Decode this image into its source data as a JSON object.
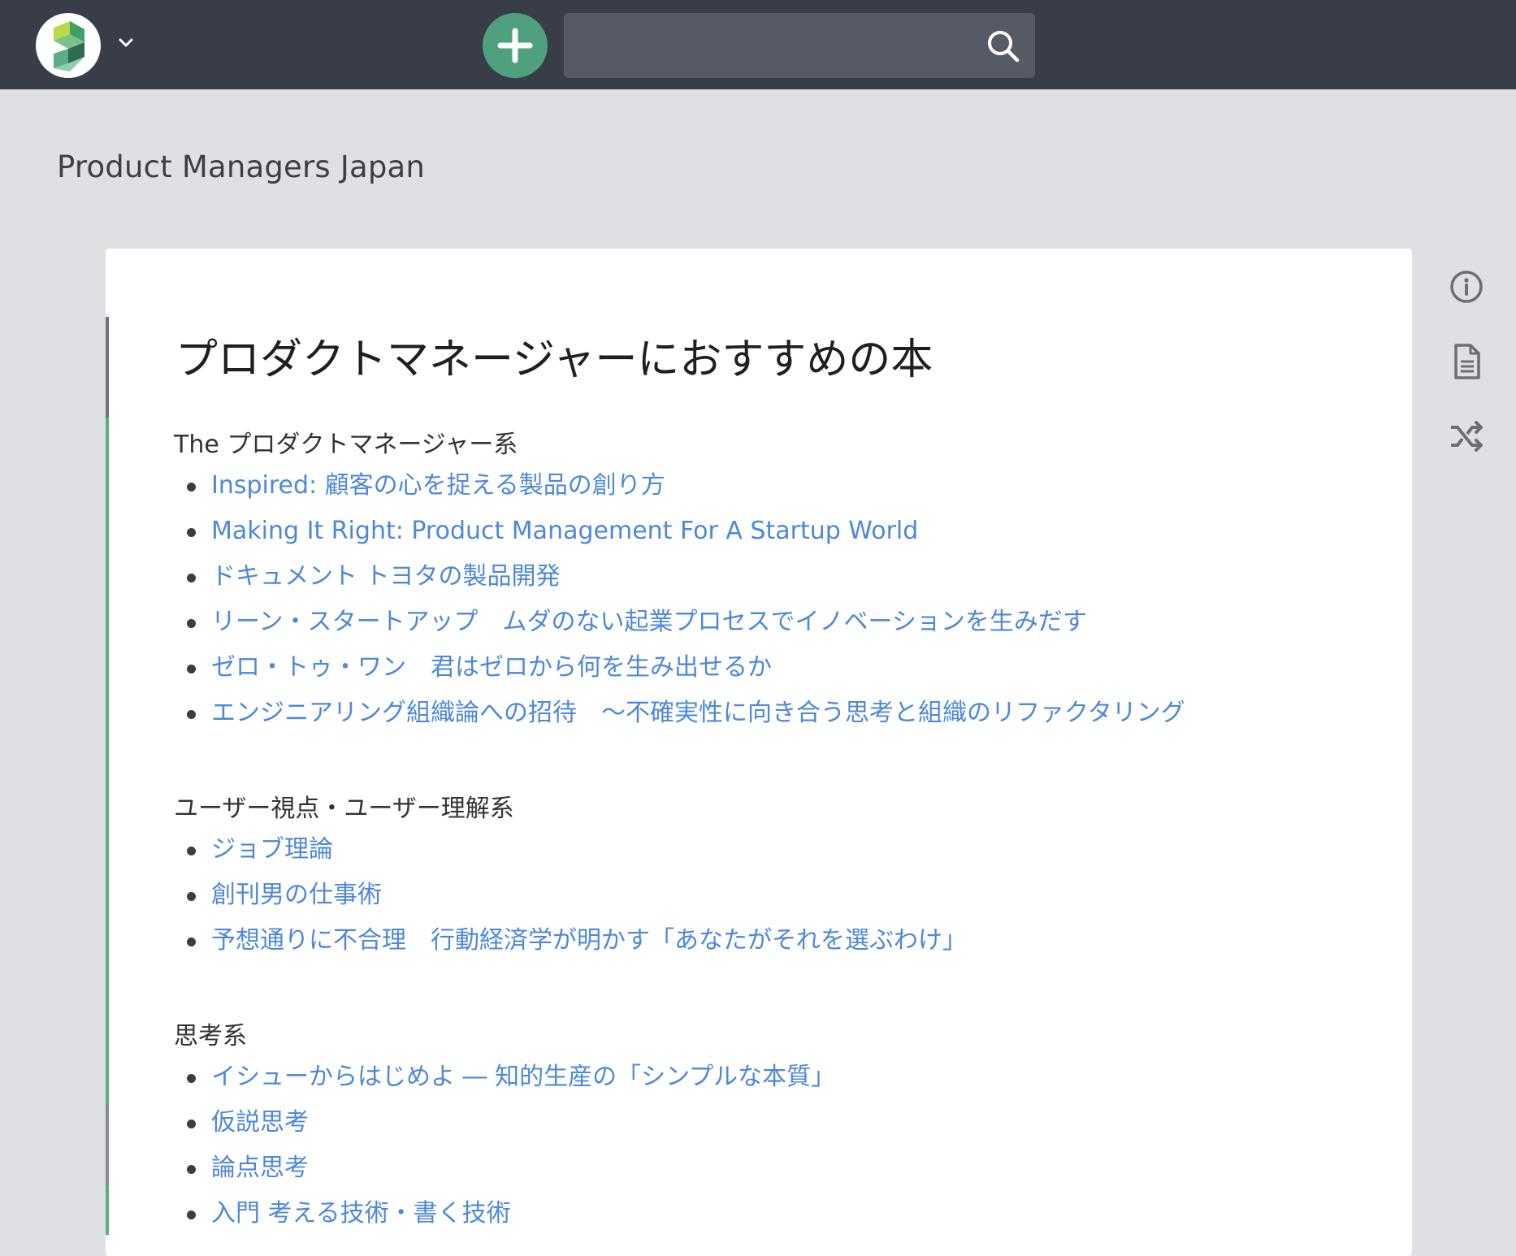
{
  "header": {
    "search": {
      "value": "",
      "placeholder": ""
    },
    "icons": [
      "app-logo",
      "chevron-down-icon",
      "plus-icon",
      "search-icon"
    ]
  },
  "project": {
    "name": "Product Managers Japan"
  },
  "page": {
    "title": "プロダクトマネージャーにおすすめの本",
    "sections": [
      {
        "heading": "The プロダクトマネージャー系",
        "items": [
          "Inspired: 顧客の心を捉える製品の創り方",
          "Making It Right: Product Management For A Startup World",
          "ドキュメント トヨタの製品開発",
          "リーン・スタートアップ　ムダのない起業プロセスでイノベーションを生みだす",
          "ゼロ・トゥ・ワン　君はゼロから何を生み出せるか",
          "エンジニアリング組織論への招待　～不確実性に向き合う思考と組織のリファクタリング"
        ]
      },
      {
        "heading": "ユーザー視点・ユーザー理解系",
        "items": [
          "ジョブ理論",
          "創刊男の仕事術",
          "予想通りに不合理　行動経済学が明かす「あなたがそれを選ぶわけ」"
        ]
      },
      {
        "heading": "思考系",
        "items": [
          "イシューからはじめよ ― 知的生産の「シンプルな本質」",
          "仮説思考",
          "論点思考",
          "入門 考える技術・書く技術"
        ]
      }
    ]
  },
  "side_tools": [
    "info-icon",
    "document-icon",
    "shuffle-icon"
  ],
  "colors": {
    "topbar": "#383d48",
    "accent_green": "#4fa17d",
    "link": "#4d88d9",
    "background": "#dee0e4"
  }
}
